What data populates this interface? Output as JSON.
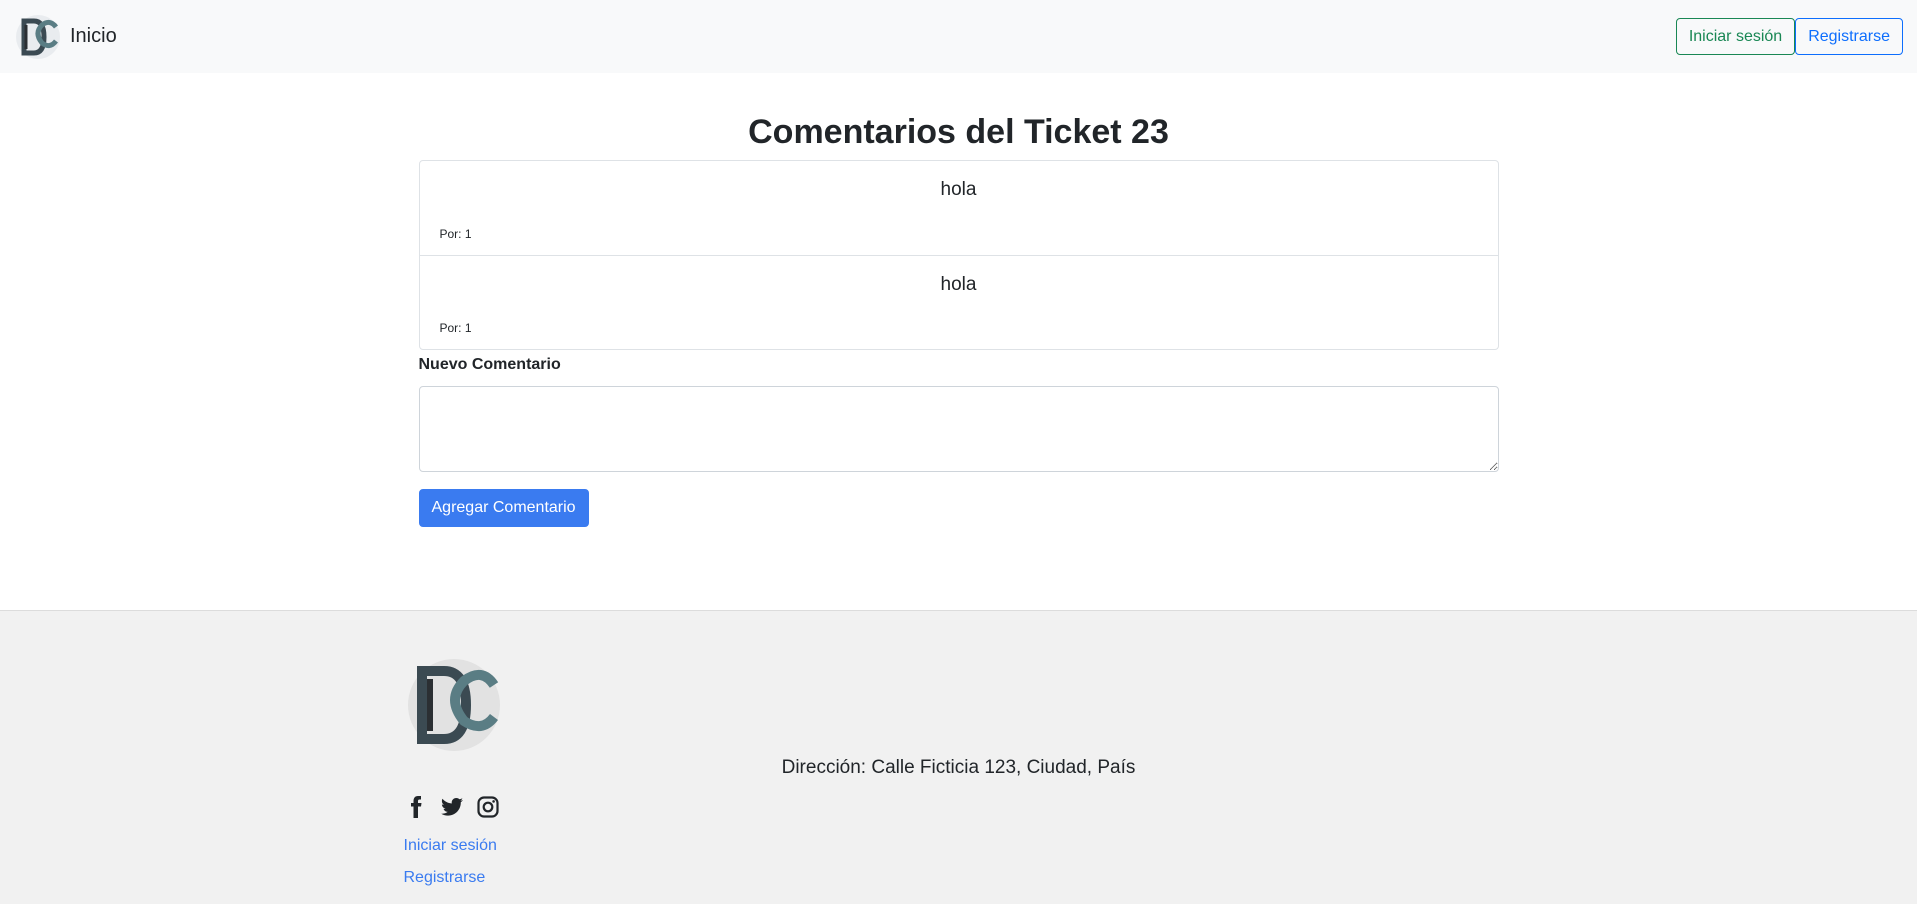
{
  "navbar": {
    "brand_text": "Inicio",
    "login_label": "Iniciar sesión",
    "register_label": "Registrarse"
  },
  "main": {
    "title": "Comentarios del Ticket 23",
    "comments": [
      {
        "text": "hola",
        "author": "Por: 1"
      },
      {
        "text": "hola",
        "author": "Por: 1"
      }
    ],
    "new_comment_label": "Nuevo Comentario",
    "textarea_value": "",
    "submit_label": "Agregar Comentario"
  },
  "footer": {
    "address": "Dirección: Calle Ficticia 123, Ciudad, País",
    "social": [
      "facebook-icon",
      "twitter-icon",
      "instagram-icon"
    ],
    "links": {
      "login": "Iniciar sesión",
      "register": "Registrarse"
    }
  },
  "colors": {
    "primary": "#3a7bf0",
    "success": "#198754",
    "navbar_bg": "#f8f9fa",
    "footer_bg": "#f1f1f1"
  }
}
